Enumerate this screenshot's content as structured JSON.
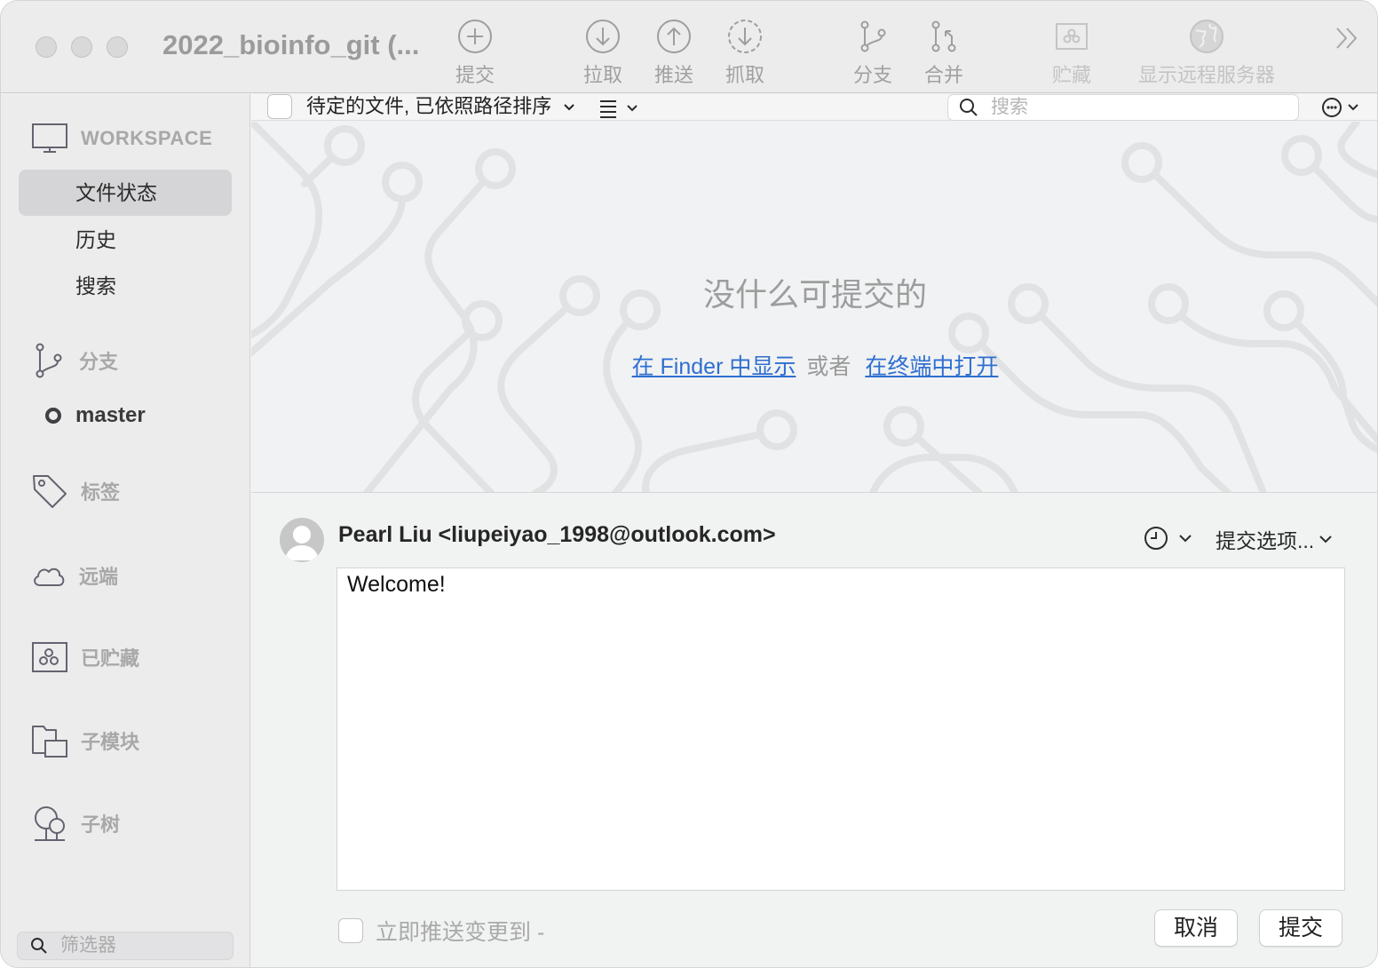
{
  "window": {
    "title": "2022_bioinfo_git (..."
  },
  "toolbar": {
    "commit": "提交",
    "pull": "拉取",
    "push": "推送",
    "fetch": "抓取",
    "branch": "分支",
    "merge": "合并",
    "stash": "贮藏",
    "show_remote": "显示远程服务器"
  },
  "sidebar": {
    "workspace": "WORKSPACE",
    "file_status": "文件状态",
    "history": "历史",
    "search": "搜索",
    "branches": "分支",
    "current_branch": "master",
    "tags": "标签",
    "remotes": "远端",
    "stashes": "已贮藏",
    "submodules": "子模块",
    "subtrees": "子树",
    "filter_placeholder": "筛选器"
  },
  "file_list": {
    "sort_label": "待定的文件, 已依照路径排序",
    "search_placeholder": "搜索"
  },
  "empty_state": {
    "title": "没什么可提交的",
    "finder_link": "在 Finder 中显示",
    "or": "或者",
    "terminal_link": "在终端中打开"
  },
  "commit": {
    "author": "Pearl Liu <liupeiyao_1998@outlook.com>",
    "options": "提交选项...",
    "message": "Welcome!",
    "push_label": "立即推送变更到 -",
    "cancel": "取消",
    "submit": "提交"
  }
}
